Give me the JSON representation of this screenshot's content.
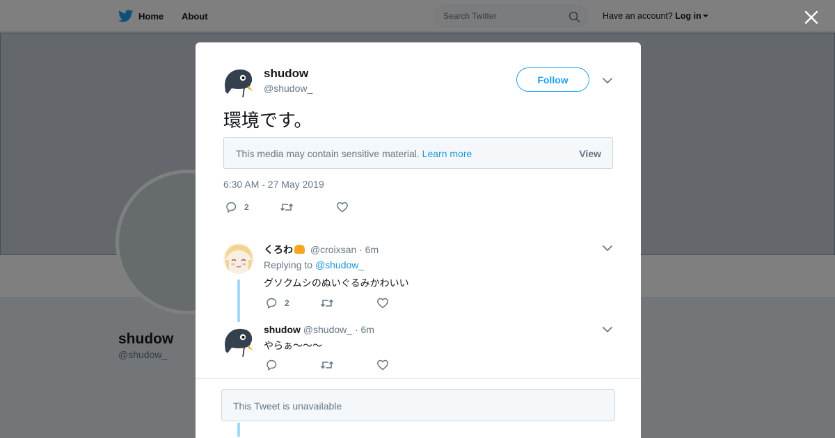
{
  "nav": {
    "home_label": "Home",
    "about_label": "About",
    "search_placeholder": "Search Twitter",
    "account_prompt": "Have an account?",
    "login_label": "Log in"
  },
  "background_profile": {
    "name": "shudow",
    "handle": "@shudow_"
  },
  "tweet": {
    "author_name": "shudow",
    "author_handle": "@shudow_",
    "follow_label": "Follow",
    "text": "環境です。",
    "sensitive_message": "This media may contain sensitive material.",
    "learn_more_label": "Learn more",
    "view_label": "View",
    "timestamp": "6:30 AM - 27 May 2019",
    "reply_count": "2"
  },
  "replies": [
    {
      "name": "くろわ",
      "handle": "@croixsan",
      "time": "· 6m",
      "replying_prefix": "Replying to",
      "replying_to": "@shudow_",
      "text": "グソクムシのぬいぐるみかわいい",
      "reply_count": "2"
    },
    {
      "name": "shudow",
      "handle": "@shudow_",
      "time": "· 6m",
      "text": "やらぁ～～～"
    }
  ],
  "unavailable_text": "This Tweet is unavailable",
  "colors": {
    "accent": "#1da1f2",
    "link": "#1b95e0",
    "thread_line": "#a5d8f7",
    "muted": "#657786"
  },
  "icons": [
    "twitter-bird-icon",
    "search-icon",
    "close-icon",
    "chevron-down-icon",
    "reply-icon",
    "retweet-icon",
    "heart-icon"
  ]
}
